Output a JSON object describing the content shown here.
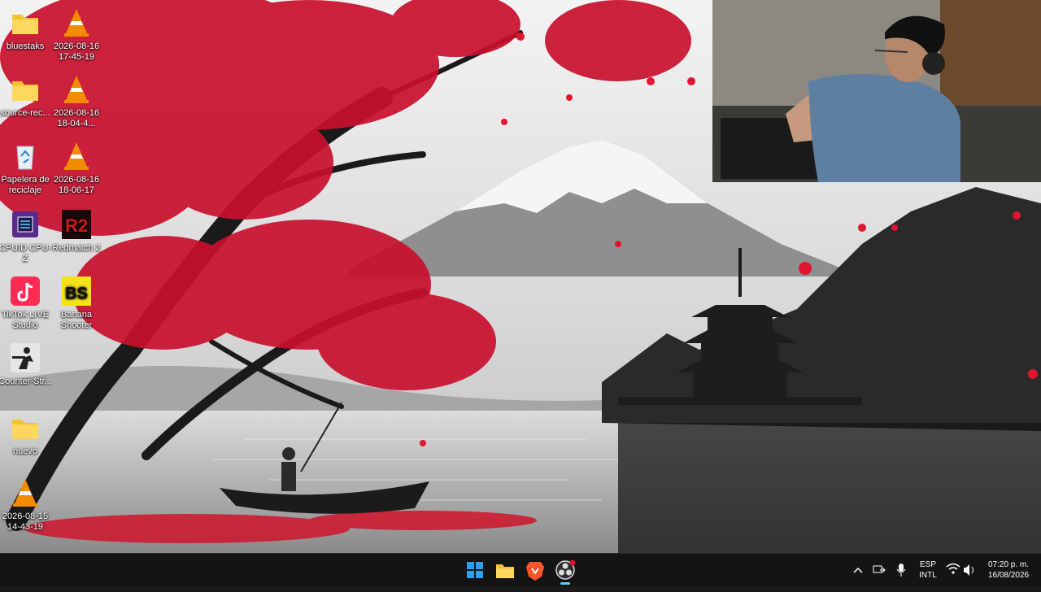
{
  "desktop": {
    "icons": [
      {
        "label": "bluestaks",
        "icon": "folder-icon"
      },
      {
        "label": "2026-08-16\n17-45-19",
        "icon": "vlc-icon"
      },
      {
        "label": "source-rec...",
        "icon": "folder-icon"
      },
      {
        "label": "2026-08-16\n18-04-4...",
        "icon": "vlc-icon"
      },
      {
        "label": "Papelera de\nreciclaje",
        "icon": "recycle-bin-icon"
      },
      {
        "label": "2026-08-16\n18-06-17",
        "icon": "vlc-icon"
      },
      {
        "label": "CPUID CPU-Z",
        "icon": "cpu-z-icon"
      },
      {
        "label": "Redmatch 2",
        "icon": "redmatch-icon",
        "glyph_text": "R2"
      },
      {
        "label": "TikTok LIVE\nStudio",
        "icon": "tiktok-live-icon"
      },
      {
        "label": "Banana\nShooter",
        "icon": "banana-shooter-icon",
        "glyph_text": "BS"
      },
      {
        "label": "Counter-Str...",
        "icon": "counter-strike-icon"
      },
      {
        "label": "nuevo",
        "icon": "folder-icon"
      },
      {
        "label": "2026-08-15\n14-43-19",
        "icon": "vlc-icon"
      }
    ]
  },
  "taskbar": {
    "apps": [
      {
        "name": "start",
        "icon": "windows-start-icon"
      },
      {
        "name": "file-explorer",
        "icon": "folder-icon"
      },
      {
        "name": "brave",
        "icon": "brave-browser-icon"
      },
      {
        "name": "obs",
        "icon": "obs-studio-icon"
      }
    ],
    "tray": {
      "language": "ESP",
      "layout": "INTL",
      "time": "07:20 p. m.",
      "date": "16/08/2026"
    }
  },
  "colors": {
    "taskbar_bg": "#141414",
    "maple_red": "#c8102e",
    "folder_yellow": "#f4c430",
    "vlc_orange": "#f28c00",
    "windows_blue": "#2aa0f0"
  }
}
